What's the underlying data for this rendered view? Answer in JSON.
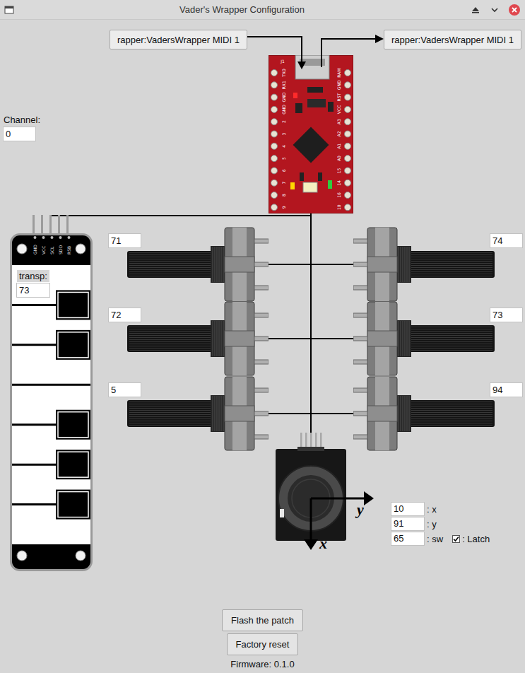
{
  "window": {
    "title": "Vader's Wrapper Configuration"
  },
  "midi": {
    "input": "rapper:VadersWrapper MIDI 1",
    "output": "rapper:VadersWrapper MIDI 1"
  },
  "board": {
    "header": "J1",
    "left_pins": [
      "TX0",
      "RX1",
      "GND",
      "GND",
      "2",
      "3",
      "4",
      "5",
      "6",
      "7",
      "8",
      "9"
    ],
    "right_pins": [
      "RAW",
      "GND",
      "RST",
      "VCC",
      "A3",
      "A2",
      "A1",
      "A0",
      "15",
      "14",
      "16",
      "10"
    ]
  },
  "channel": {
    "label": "Channel:",
    "value": "0"
  },
  "keyboard": {
    "pins": [
      "GND",
      "VCC",
      "SCL",
      "SDO",
      "RSB"
    ],
    "transpose_label": "transp:",
    "transpose": "73"
  },
  "pots": [
    {
      "side": "left",
      "value": "71"
    },
    {
      "side": "left",
      "value": "72"
    },
    {
      "side": "left",
      "value": "5"
    },
    {
      "side": "right",
      "value": "74"
    },
    {
      "side": "right",
      "value": "73"
    },
    {
      "side": "right",
      "value": "94"
    }
  ],
  "joystick": {
    "arrows": {
      "right": "y",
      "down": "x"
    },
    "axes": [
      {
        "label": ": x",
        "value": "10"
      },
      {
        "label": ": y",
        "value": "91"
      },
      {
        "label": ": sw",
        "value": "65"
      }
    ],
    "latch": {
      "label": ": Latch",
      "checked": true
    }
  },
  "buttons": [
    "Flash the patch",
    "Factory reset"
  ],
  "firmware": "Firmware: 0.1.0"
}
